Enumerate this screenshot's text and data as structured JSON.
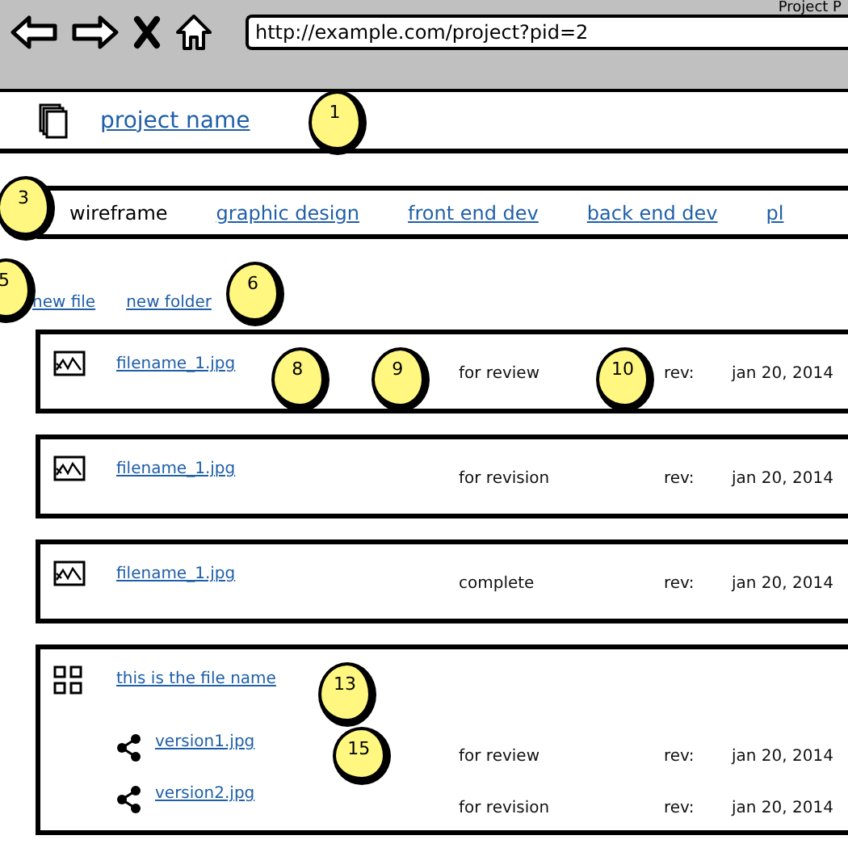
{
  "window": {
    "title": "Project P"
  },
  "toolbar": {
    "url": "http://example.com/project?pid=2"
  },
  "header": {
    "title": "project name",
    "marker": "1"
  },
  "tabs": {
    "marker": "3",
    "items": [
      {
        "label": "wireframe",
        "selected": true
      },
      {
        "label": "graphic design",
        "selected": false
      },
      {
        "label": "front end dev",
        "selected": false
      },
      {
        "label": "back end dev",
        "selected": false
      },
      {
        "label": "pl",
        "selected": false
      }
    ]
  },
  "actions": {
    "lead_marker": "5",
    "links": [
      "new file",
      "new folder"
    ],
    "trail_marker": "6"
  },
  "files": [
    {
      "kind": "image",
      "name": "filename_1.jpg",
      "name_marker": "8",
      "status_marker": "9",
      "status": "for review",
      "rev_marker": "10",
      "rev_label": "rev:",
      "date": "jan 20, 2014"
    },
    {
      "kind": "image",
      "name": "filename_1.jpg",
      "status": "for revision",
      "rev_label": "rev:",
      "date": "jan 20, 2014"
    },
    {
      "kind": "image",
      "name": "filename_1.jpg",
      "status": "complete",
      "rev_label": "rev:",
      "date": "jan 20, 2014"
    },
    {
      "kind": "folder",
      "name": "this is the file name",
      "name_marker": "13",
      "versions": [
        {
          "name": "version1.jpg",
          "name_marker": "15",
          "status": "for review",
          "rev_label": "rev:",
          "date": "jan 20, 2014"
        },
        {
          "name": "version2.jpg",
          "status": "for revision",
          "rev_label": "rev:",
          "date": "jan 20, 2014"
        }
      ]
    }
  ]
}
